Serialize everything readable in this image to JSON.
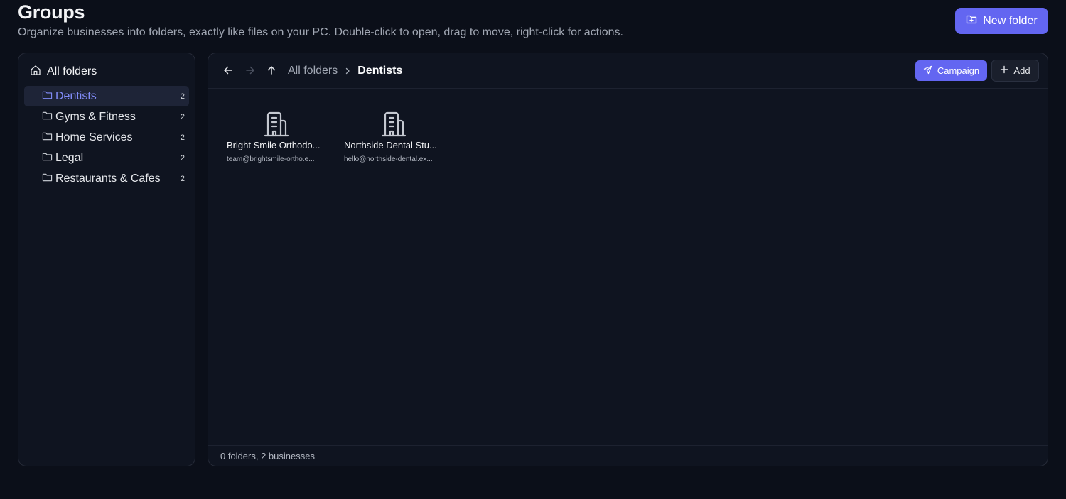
{
  "header": {
    "title": "Groups",
    "subtitle": "Organize businesses into folders, exactly like files on your PC. Double-click to open, drag to move, right-click for actions.",
    "new_folder_label": "New folder"
  },
  "sidebar": {
    "root_label": "All folders",
    "items": [
      {
        "label": "Dentists",
        "count": "2"
      },
      {
        "label": "Gyms & Fitness",
        "count": "2"
      },
      {
        "label": "Home Services",
        "count": "2"
      },
      {
        "label": "Legal",
        "count": "2"
      },
      {
        "label": "Restaurants & Cafes",
        "count": "2"
      }
    ]
  },
  "toolbar": {
    "breadcrumb_root": "All folders",
    "breadcrumb_current": "Dentists",
    "campaign_label": "Campaign",
    "add_label": "Add"
  },
  "businesses": [
    {
      "name": "Bright Smile Orthodo...",
      "email": "team@brightsmile-ortho.e..."
    },
    {
      "name": "Northside Dental Stu...",
      "email": "hello@northside-dental.ex..."
    }
  ],
  "status": "0 folders, 2 businesses",
  "colors": {
    "accent": "#6366f1",
    "active_folder_text": "#818cf8",
    "background": "#0b0f19",
    "panel": "#0f1420"
  },
  "icons": {
    "new_folder": "folder-plus-icon",
    "root": "home-icon",
    "folder": "folder-icon",
    "back": "arrow-left-icon",
    "forward": "arrow-right-icon",
    "up": "arrow-up-icon",
    "breadcrumb_separator": "chevron-right-icon",
    "campaign": "send-icon",
    "add": "plus-icon",
    "business": "building-icon"
  }
}
